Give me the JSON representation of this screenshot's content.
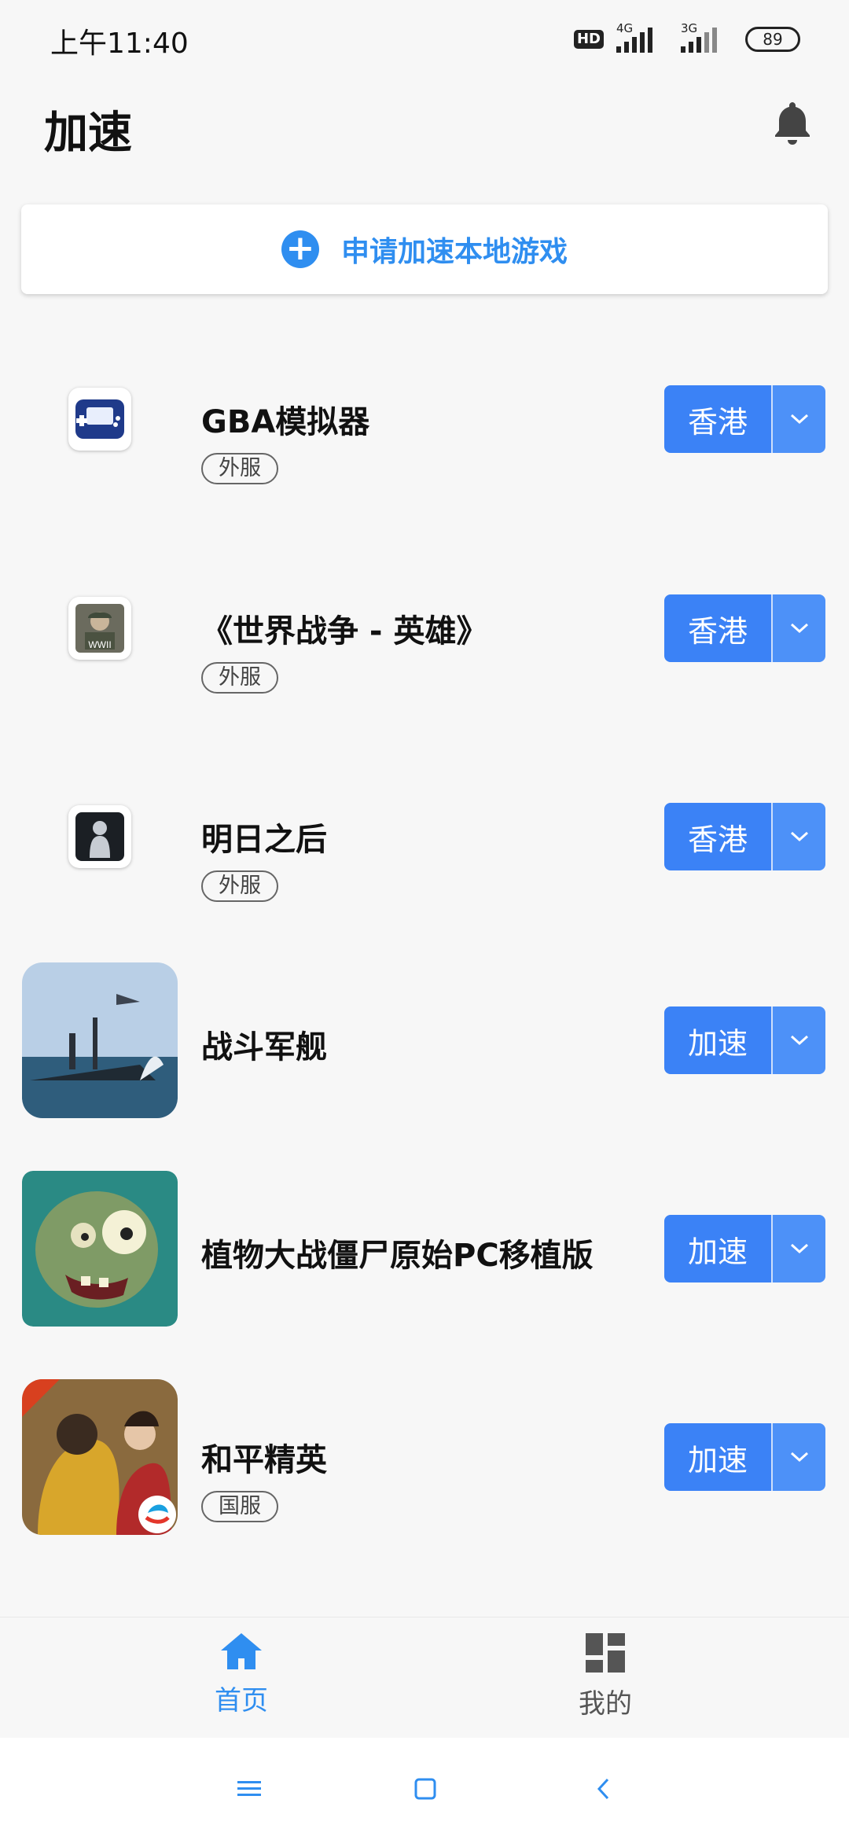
{
  "status_bar": {
    "time": "上午11:40",
    "hd": "HD",
    "net1": "4G",
    "net2": "3G",
    "battery": "89"
  },
  "header": {
    "title": "加速",
    "bell_icon": "bell-icon"
  },
  "add_local": {
    "label": "申请加速本地游戏",
    "icon": "plus-circle-icon"
  },
  "games": [
    {
      "title": "GBA模拟器",
      "tag": "外服",
      "button": "香港",
      "icon": "gba-emulator-icon"
    },
    {
      "title": "《世界战争 - 英雄》",
      "tag": "外服",
      "button": "香港",
      "icon": "wwii-soldier-icon"
    },
    {
      "title": "明日之后",
      "tag": "外服",
      "button": "香港",
      "icon": "silhouette-icon"
    },
    {
      "title": "战斗军舰",
      "tag": "",
      "button": "加速",
      "icon": "battleship-icon"
    },
    {
      "title": "植物大战僵尸原始PC移植版",
      "tag": "",
      "button": "加速",
      "icon": "zombie-icon"
    },
    {
      "title": "和平精英",
      "tag": "国服",
      "button": "加速",
      "icon": "peace-elite-icon"
    }
  ],
  "bottom_nav": {
    "home_label": "首页",
    "mine_label": "我的"
  },
  "colors": {
    "accent": "#2f8ef0",
    "button": "#3b82f6",
    "background": "#f7f7f7"
  }
}
